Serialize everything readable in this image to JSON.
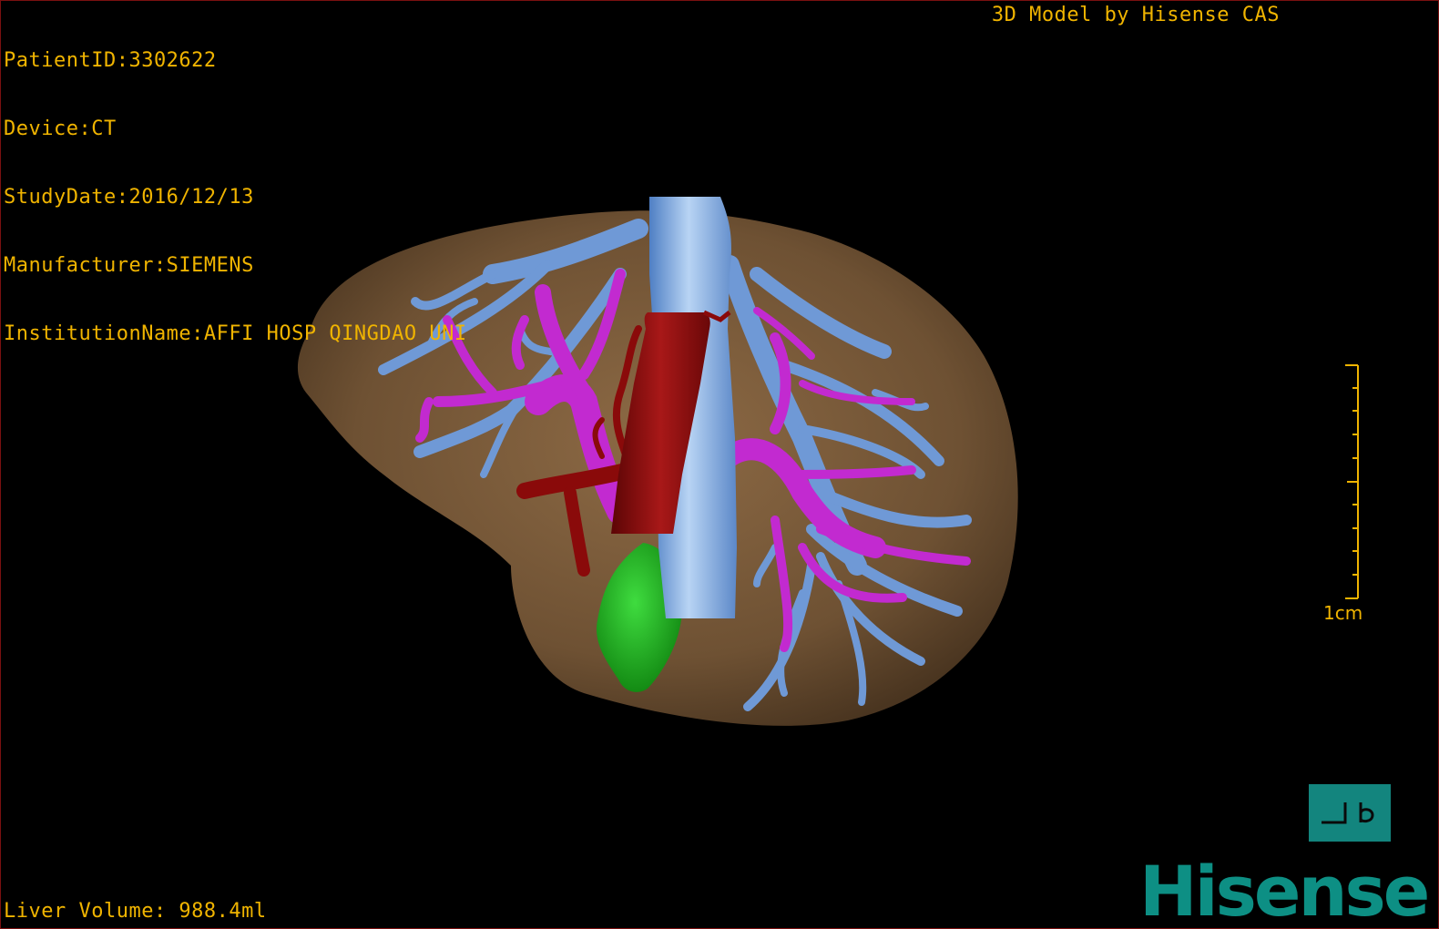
{
  "patient_info": {
    "patient_id": "PatientID:3302622",
    "device": "Device:CT",
    "study_date": "StudyDate:2016/12/13",
    "manufacturer": "Manufacturer:SIEMENS",
    "institution": "InstitutionName:AFFI HOSP QINGDAO UNI"
  },
  "model_label": "3D Model by Hisense CAS",
  "liver_volume": "Liver Volume: 988.4ml",
  "scale_bar": {
    "label": "1cm"
  },
  "view_button": {
    "icon": "orientation-icon",
    "glyphs": "⅃d"
  },
  "logo": "Hisense",
  "colors": {
    "overlay_text": "#f0b400",
    "liver": "#6e5133",
    "hepatic_vein": "#6f99d6",
    "portal_vein": "#c22ad0",
    "artery": "#8a0a0a",
    "tumor": "#1ea51e",
    "brand": "#0d8f84"
  }
}
